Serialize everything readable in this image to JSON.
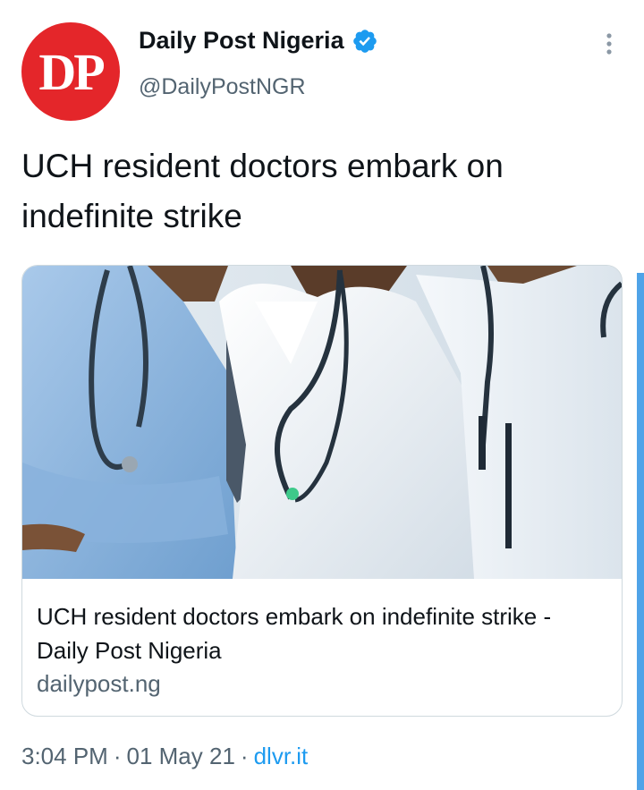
{
  "tweet": {
    "author": {
      "avatar_text": "DP",
      "display_name": "Daily Post Nigeria",
      "verified": true,
      "handle": "@DailyPostNGR"
    },
    "text": "UCH resident doctors embark on indefinite strike",
    "card": {
      "title": "UCH resident doctors embark on indefinite strike - Daily Post Nigeria",
      "domain": "dailypost.ng",
      "image_description_icon": "doctors-with-stethoscopes-image"
    },
    "time": "3:04 PM",
    "date": "01 May 21",
    "separator": "·",
    "source": "dlvr.it"
  },
  "icons": {
    "more": "more-vertical-icon",
    "verified": "verified-badge-icon"
  },
  "colors": {
    "brand_red": "#e4262a",
    "verified_blue": "#1d9bf0",
    "link_blue": "#1d9bf0",
    "secondary_text": "#536471",
    "scrollbar": "#4fa3e8"
  }
}
